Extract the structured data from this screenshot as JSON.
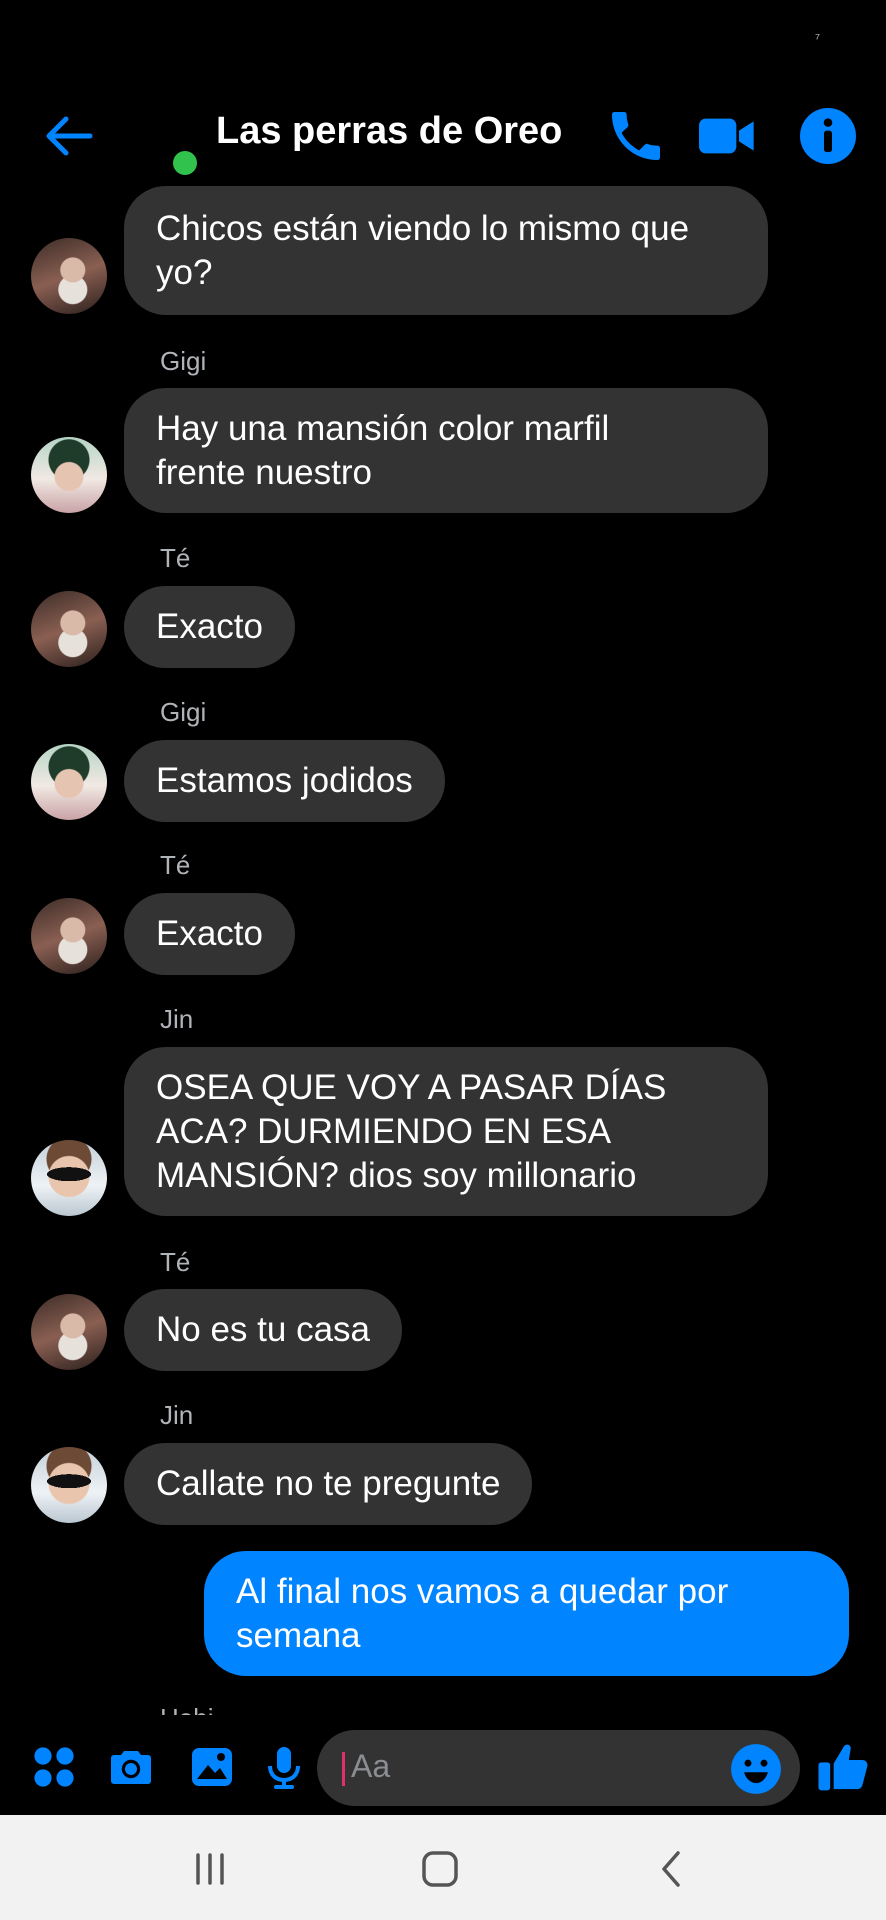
{
  "status": {
    "mark": "⁷"
  },
  "header": {
    "title": "Las perras de Oreo",
    "presence_color": "#31c24d",
    "accent": "#0084ff",
    "icons": [
      "back-arrow-icon",
      "phone-icon",
      "video-camera-icon",
      "info-icon"
    ]
  },
  "messages": [
    {
      "sender": "",
      "avatar": "te",
      "text": [
        "Chicos están viendo lo mismo que",
        "yo?"
      ]
    },
    {
      "sender": "Gigi",
      "avatar": "gigi",
      "text": [
        "Hay una mansión color marfil",
        "frente nuestro"
      ]
    },
    {
      "sender": "Té",
      "avatar": "te",
      "text": [
        "Exacto"
      ]
    },
    {
      "sender": "Gigi",
      "avatar": "gigi",
      "text": [
        "Estamos jodidos"
      ]
    },
    {
      "sender": "Té",
      "avatar": "te",
      "text": [
        "Exacto"
      ]
    },
    {
      "sender": "Jin",
      "avatar": "jin",
      "text": [
        "OSEA QUE VOY A PASAR DÍAS",
        "ACA? DURMIENDO EN ESA",
        "MANSIÓN? dios soy millonario"
      ]
    },
    {
      "sender": "Té",
      "avatar": "te",
      "text": [
        "No es tu casa"
      ]
    },
    {
      "sender": "Jin",
      "avatar": "jin",
      "text": [
        "Callate no te pregunte"
      ]
    },
    {
      "sender": "",
      "avatar": "",
      "outgoing": true,
      "text": [
        "Al final nos vamos a quedar por",
        "semana"
      ]
    },
    {
      "sender": "Hobi",
      "avatar": "",
      "text": []
    }
  ],
  "composer": {
    "placeholder": "Aa",
    "icons": [
      "apps-icon",
      "camera-icon",
      "gallery-icon",
      "microphone-icon",
      "emoji-icon",
      "thumbs-up-icon"
    ]
  },
  "navbar": {
    "icons": [
      "recent-apps-icon",
      "home-icon",
      "back-icon"
    ]
  }
}
